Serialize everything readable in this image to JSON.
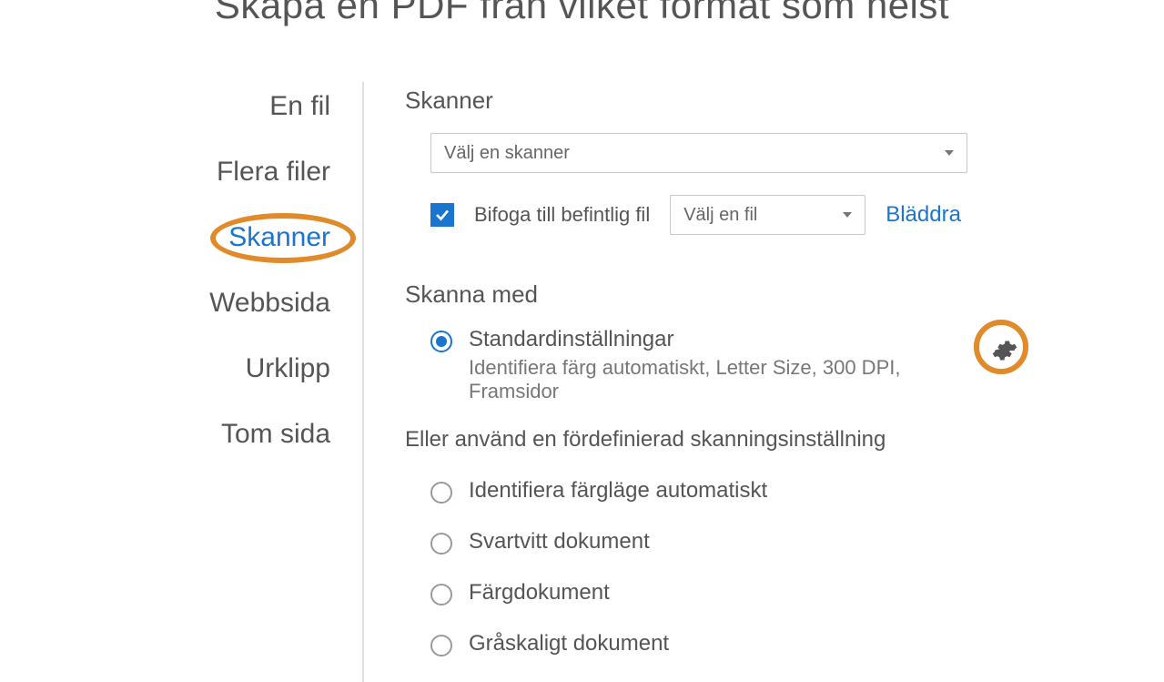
{
  "title": "Skapa en PDF från vilket format som helst",
  "sidebar": {
    "items": [
      {
        "label": "En fil"
      },
      {
        "label": "Flera filer"
      },
      {
        "label": "Skanner"
      },
      {
        "label": "Webbsida"
      },
      {
        "label": "Urklipp"
      },
      {
        "label": "Tom sida"
      }
    ]
  },
  "scanner": {
    "section_label": "Skanner",
    "select_placeholder": "Välj en skanner",
    "attach_label": "Bifoga till befintlig fil",
    "file_select_placeholder": "Välj en fil",
    "browse_label": "Bläddra"
  },
  "scan_with": {
    "section_label": "Skanna med",
    "default_label": "Standardinställningar",
    "default_sub": "Identifiera färg automatiskt, Letter Size, 300 DPI, Framsidor",
    "alt_heading": "Eller använd en fördefinierad skanningsinställning",
    "options": [
      {
        "label": "Identifiera färgläge automatiskt"
      },
      {
        "label": "Svartvitt dokument"
      },
      {
        "label": "Färgdokument"
      },
      {
        "label": "Gråskaligt dokument"
      }
    ]
  }
}
